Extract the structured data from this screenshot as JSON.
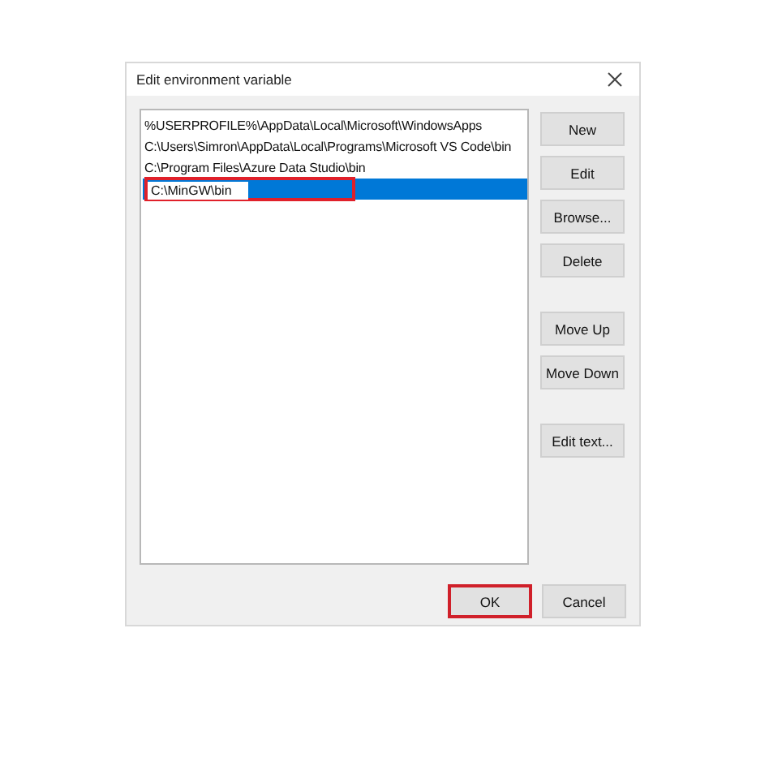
{
  "window": {
    "title": "Edit environment variable"
  },
  "entries": [
    {
      "text": "%USERPROFILE%\\AppData\\Local\\Microsoft\\WindowsApps",
      "selected": false,
      "editing": false
    },
    {
      "text": "C:\\Users\\Simron\\AppData\\Local\\Programs\\Microsoft VS Code\\bin",
      "selected": false,
      "editing": false
    },
    {
      "text": "C:\\Program Files\\Azure Data Studio\\bin",
      "selected": false,
      "editing": false
    },
    {
      "text": "C:\\MinGW\\bin",
      "selected": true,
      "editing": true,
      "highlighted": true
    }
  ],
  "side_button_groups": [
    [
      {
        "label": "New"
      },
      {
        "label": "Edit"
      },
      {
        "label": "Browse..."
      },
      {
        "label": "Delete"
      }
    ],
    [
      {
        "label": "Move Up"
      },
      {
        "label": "Move Down"
      }
    ],
    [
      {
        "label": "Edit text..."
      }
    ]
  ],
  "footer_buttons": [
    {
      "label": "OK",
      "highlighted": true
    },
    {
      "label": "Cancel",
      "highlighted": false
    }
  ]
}
